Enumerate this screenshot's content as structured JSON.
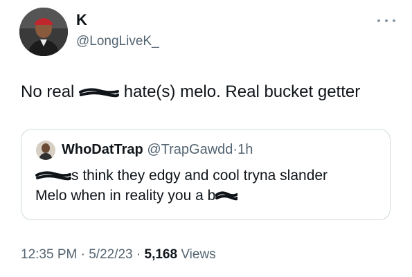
{
  "author": {
    "name": "K",
    "handle": "@LongLiveK_"
  },
  "tweet": {
    "text_before": "No real ",
    "text_after": " hate(s) melo. Real bucket getter"
  },
  "quoted": {
    "name": "WhoDatTrap",
    "handle": "@TrapGawdd",
    "separator": "·",
    "time": "1h",
    "line1_after": "s think they edgy and cool tryna slander",
    "line2_before": "Melo when in reality you a b"
  },
  "meta": {
    "time": "12:35 PM",
    "sep1": "·",
    "date": "5/22/23",
    "sep2": "·",
    "views_count": "5,168",
    "views_label": "Views"
  },
  "icons": {
    "more": "more-dots-icon",
    "redaction": "scribble-redaction"
  },
  "colors": {
    "text": "#0f1419",
    "secondary": "#536471",
    "border": "#cfd9de"
  }
}
